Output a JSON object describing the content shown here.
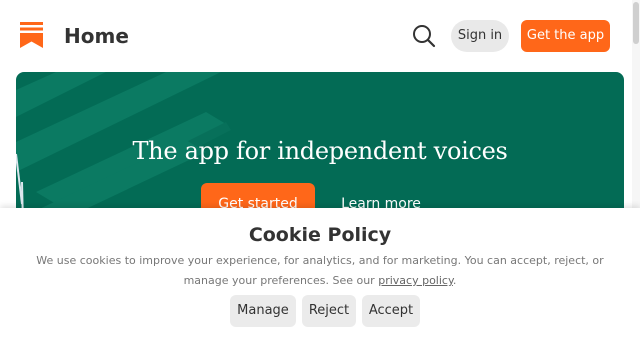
{
  "header": {
    "title": "Home",
    "sign_in_label": "Sign in",
    "get_app_label": "Get the app",
    "icons": {
      "logo": "bookmark-logo-icon",
      "search": "search-icon"
    }
  },
  "hero": {
    "headline": "The app for independent voices",
    "get_started_label": "Get started",
    "learn_more_label": "Learn more"
  },
  "cookie_banner": {
    "title": "Cookie Policy",
    "text": "We use cookies to improve your experience, for analytics, and for marketing. You can accept, reject, or manage your preferences. See our",
    "link_label": "privacy policy",
    "text_end": ".",
    "manage_label": "Manage",
    "reject_label": "Reject",
    "accept_label": "Accept"
  },
  "colors": {
    "brand_orange": "#ff6719",
    "hero_green": "#036b55",
    "button_gray": "#ebebeb",
    "text_dark": "#333333"
  }
}
